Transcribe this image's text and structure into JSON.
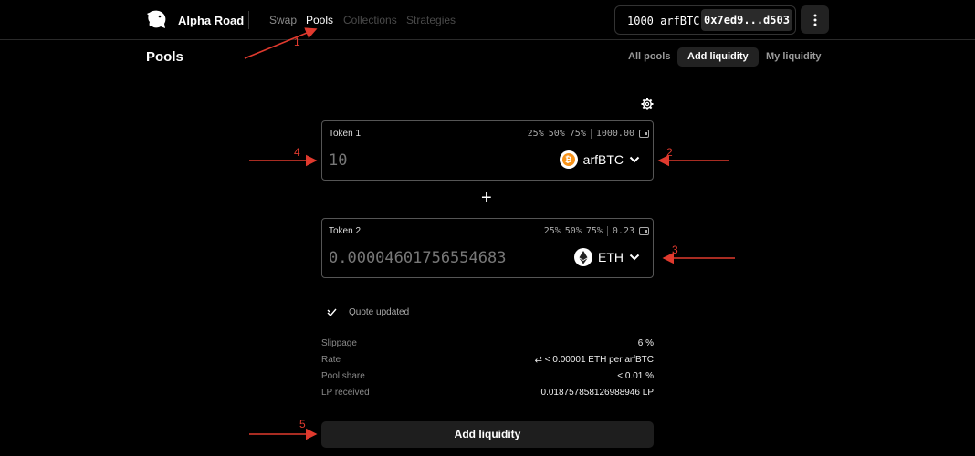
{
  "header": {
    "brand": "Alpha Road",
    "nav": [
      "Swap",
      "Pools",
      "Collections",
      "Strategies"
    ],
    "balance": "1000 arfBTC",
    "address": "0x7ed9...d503",
    "menu_icon": "more-vertical-icon"
  },
  "page": {
    "title": "Pools",
    "tabs": [
      "All pools",
      "Add liquidity",
      "My liquidity"
    ],
    "active_tab": "Add liquidity"
  },
  "token1": {
    "label": "Token 1",
    "p25": "25%",
    "p50": "50%",
    "p75": "75%",
    "balance": "1000.00",
    "value": "10",
    "symbol": "arfBTC",
    "icon": "bitcoin-icon"
  },
  "token2": {
    "label": "Token 2",
    "p25": "25%",
    "p50": "50%",
    "p75": "75%",
    "balance": "0.23",
    "value": "0.00004601756554683",
    "symbol": "ETH",
    "icon": "ethereum-icon"
  },
  "quote": {
    "text": "Quote updated"
  },
  "details": {
    "slippage_label": "Slippage",
    "slippage": "6 %",
    "rate_label": "Rate",
    "rate": "< 0.00001 ETH per arfBTC",
    "share_label": "Pool share",
    "share": "< 0.01 %",
    "lp_label": "LP received",
    "lp": "0.018757858126988946 LP"
  },
  "submit": {
    "label": "Add liquidity"
  },
  "annotations": [
    "1",
    "2",
    "3",
    "4",
    "5"
  ],
  "colors": {
    "annotation": "#e03a2e",
    "bitcoin": "#f7931a"
  }
}
